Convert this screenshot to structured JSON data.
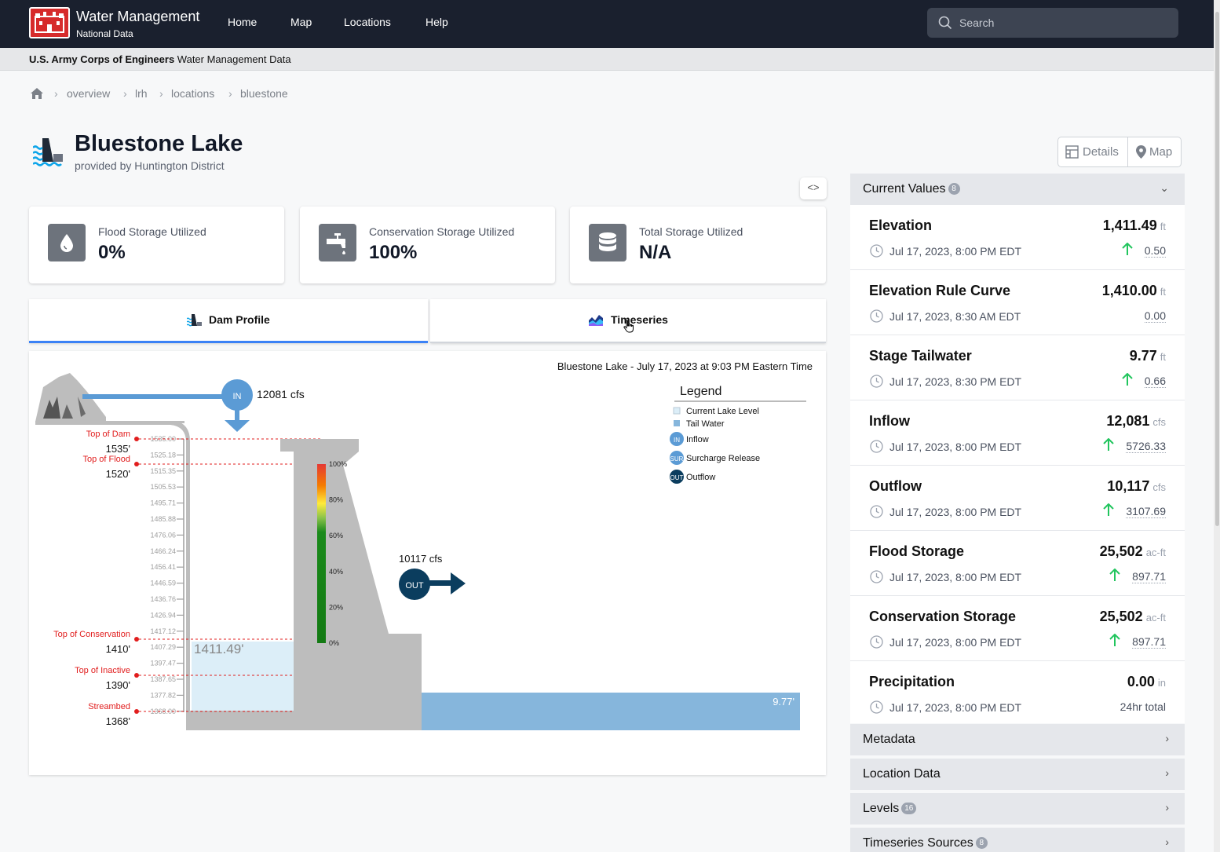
{
  "header": {
    "brand_title": "Water Management",
    "brand_subtitle": "National Data",
    "nav": [
      "Home",
      "Map",
      "Locations",
      "Help"
    ],
    "search_placeholder": "Search"
  },
  "subbar": {
    "org": "U.S. Army Corps of Engineers",
    "rest": "Water Management Data"
  },
  "breadcrumb": [
    "overview",
    "lrh",
    "locations",
    "bluestone"
  ],
  "page": {
    "title": "Bluestone Lake",
    "provided_by": "provided by Huntington District",
    "details_label": "Details",
    "map_label": "Map",
    "toggle_label": "<>"
  },
  "stats": [
    {
      "label": "Flood Storage Utilized",
      "value": "0%",
      "icon": "water-drop-icon"
    },
    {
      "label": "Conservation Storage Utilized",
      "value": "100%",
      "icon": "faucet-icon"
    },
    {
      "label": "Total Storage Utilized",
      "value": "N/A",
      "icon": "database-icon"
    }
  ],
  "tabs": {
    "dam_profile": "Dam Profile",
    "timeseries": "Timeseries"
  },
  "chart": {
    "title": "Bluestone Lake - July 17, 2023 at 9:03 PM Eastern Time",
    "inflow_label": "IN",
    "inflow_value": "12081 cfs",
    "outflow_label": "OUT",
    "outflow_value": "10117 cfs",
    "legend_title": "Legend",
    "legend": [
      "Current Lake Level",
      "Tail Water",
      "Inflow",
      "Surcharge Release",
      "Outflow"
    ],
    "legend_sur": "SUR",
    "ruler_ticks": [
      "1535.00",
      "1525.18",
      "1515.35",
      "1505.53",
      "1495.71",
      "1485.88",
      "1476.06",
      "1466.24",
      "1456.41",
      "1446.59",
      "1436.76",
      "1426.94",
      "1417.12",
      "1407.29",
      "1397.47",
      "1387.65",
      "1377.82",
      "1368.00"
    ],
    "levels": [
      {
        "name": "Top of Dam",
        "value": "1535'"
      },
      {
        "name": "Top of Flood",
        "value": "1520'"
      },
      {
        "name": "Top of Conservation",
        "value": "1410'"
      },
      {
        "name": "Top of Inactive",
        "value": "1390'"
      },
      {
        "name": "Streambed",
        "value": "1368'"
      }
    ],
    "gauge_labels": [
      "100%",
      "80%",
      "60%",
      "40%",
      "20%",
      "0%"
    ],
    "lake_level": "1411.49'",
    "tailwater": "9.77'"
  },
  "sidebar": {
    "current_values_label": "Current Values",
    "current_values_count": "8",
    "items": [
      {
        "name": "Elevation",
        "value": "1,411.49",
        "unit": "ft",
        "time": "Jul 17, 2023, 8:00 PM EDT",
        "delta": "0.50",
        "up": true
      },
      {
        "name": "Elevation Rule Curve",
        "value": "1,410.00",
        "unit": "ft",
        "time": "Jul 17, 2023, 8:30 AM EDT",
        "delta": "0.00",
        "up": false
      },
      {
        "name": "Stage Tailwater",
        "value": "9.77",
        "unit": "ft",
        "time": "Jul 17, 2023, 8:30 PM EDT",
        "delta": "0.66",
        "up": true
      },
      {
        "name": "Inflow",
        "value": "12,081",
        "unit": "cfs",
        "time": "Jul 17, 2023, 8:00 PM EDT",
        "delta": "5726.33",
        "up": true
      },
      {
        "name": "Outflow",
        "value": "10,117",
        "unit": "cfs",
        "time": "Jul 17, 2023, 8:00 PM EDT",
        "delta": "3107.69",
        "up": true
      },
      {
        "name": "Flood Storage",
        "value": "25,502",
        "unit": "ac-ft",
        "time": "Jul 17, 2023, 8:00 PM EDT",
        "delta": "897.71",
        "up": true
      },
      {
        "name": "Conservation Storage",
        "value": "25,502",
        "unit": "ac-ft",
        "time": "Jul 17, 2023, 8:00 PM EDT",
        "delta": "897.71",
        "up": true
      },
      {
        "name": "Precipitation",
        "value": "0.00",
        "unit": "in",
        "time": "Jul 17, 2023, 8:00 PM EDT",
        "delta": "24hr total",
        "up": false
      }
    ],
    "metadata_label": "Metadata",
    "location_data_label": "Location Data",
    "levels_label": "Levels",
    "levels_count": "16",
    "timeseries_sources_label": "Timeseries Sources",
    "timeseries_sources_count": "8"
  },
  "colors": {
    "nav_bg": "#1a202e",
    "accent": "#3b82f6",
    "up_arrow": "#22c55e",
    "level_red": "#e11d1d",
    "flow_blue": "#5b9bd5",
    "outflow_navy": "#0b3d5e"
  }
}
